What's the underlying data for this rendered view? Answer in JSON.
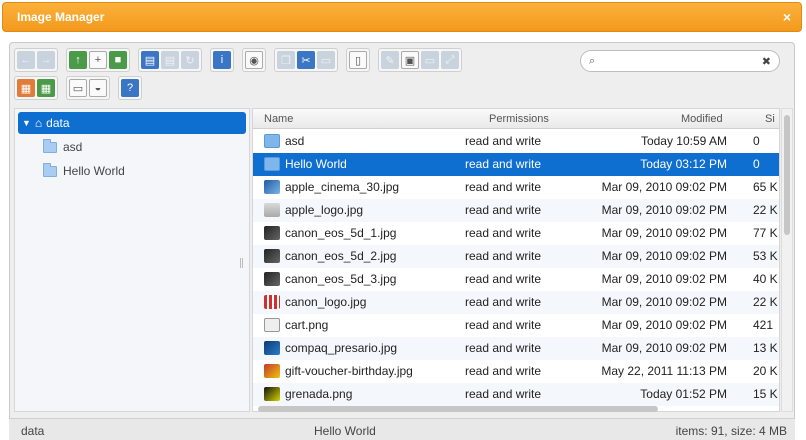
{
  "window": {
    "title": "Image Manager",
    "close_glyph": "×"
  },
  "toolbar": {
    "row1": [
      [
        {
          "icon": "back-icon",
          "glyph": "←",
          "style": "dis"
        },
        {
          "icon": "forward-icon",
          "glyph": "→",
          "style": "dis"
        }
      ],
      [
        {
          "icon": "upload-icon",
          "glyph": "↑",
          "style": "green"
        },
        {
          "icon": "new-file-icon",
          "glyph": "+",
          "style": "white"
        },
        {
          "icon": "save-icon",
          "glyph": "■",
          "style": "green"
        }
      ],
      [
        {
          "icon": "open-icon",
          "glyph": "▤",
          "style": "blue"
        },
        {
          "icon": "print-icon",
          "glyph": "▤",
          "style": "dis"
        },
        {
          "icon": "refresh-icon",
          "glyph": "↻",
          "style": "dis"
        }
      ],
      [
        {
          "icon": "info-icon",
          "glyph": "i",
          "style": "blue"
        }
      ],
      [
        {
          "icon": "preview-icon",
          "glyph": "◉",
          "style": "white"
        }
      ],
      [
        {
          "icon": "copy-icon",
          "glyph": "❐",
          "style": "dis"
        },
        {
          "icon": "cut-icon",
          "glyph": "✂",
          "style": "blue"
        },
        {
          "icon": "paste-icon",
          "glyph": "▭",
          "style": "dis"
        }
      ],
      [
        {
          "icon": "delete-icon",
          "glyph": "▯",
          "style": "white"
        }
      ],
      [
        {
          "icon": "edit-icon",
          "glyph": "✎",
          "style": "dis"
        },
        {
          "icon": "select-icon",
          "glyph": "▣",
          "style": "white"
        },
        {
          "icon": "duplicate-icon",
          "glyph": "▭",
          "style": "dis"
        },
        {
          "icon": "resize-icon",
          "glyph": "⤢",
          "style": "dis"
        }
      ]
    ],
    "row2": [
      [
        {
          "icon": "extract-icon",
          "glyph": "▦",
          "style": "orange"
        },
        {
          "icon": "archive-icon",
          "glyph": "▦",
          "style": "green"
        }
      ],
      [
        {
          "icon": "view-icon",
          "glyph": "▭",
          "style": "white"
        },
        {
          "icon": "sort-icon",
          "glyph": "◒",
          "style": "white"
        }
      ],
      [
        {
          "icon": "help-icon",
          "glyph": "?",
          "style": "blue"
        }
      ]
    ]
  },
  "search": {
    "value": "",
    "placeholder": ""
  },
  "tree": {
    "root": "data",
    "children": [
      "asd",
      "Hello World"
    ]
  },
  "columns": {
    "name": "Name",
    "permissions": "Permissions",
    "modified": "Modified",
    "size": "Si"
  },
  "files": [
    {
      "name": "asd",
      "permissions": "read and write",
      "modified": "Today 10:59 AM",
      "size": "0",
      "icon": "folder-i"
    },
    {
      "name": "Hello World",
      "permissions": "read and write",
      "modified": "Today 03:12 PM",
      "size": "0",
      "icon": "folder-i"
    },
    {
      "name": "apple_cinema_30.jpg",
      "permissions": "read and write",
      "modified": "Mar 09, 2010 09:02 PM",
      "size": "65 K",
      "icon": "blue-i"
    },
    {
      "name": "apple_logo.jpg",
      "permissions": "read and write",
      "modified": "Mar 09, 2010 09:02 PM",
      "size": "22 K",
      "icon": "grey-i"
    },
    {
      "name": "canon_eos_5d_1.jpg",
      "permissions": "read and write",
      "modified": "Mar 09, 2010 09:02 PM",
      "size": "77 K",
      "icon": "dark-i"
    },
    {
      "name": "canon_eos_5d_2.jpg",
      "permissions": "read and write",
      "modified": "Mar 09, 2010 09:02 PM",
      "size": "53 K",
      "icon": "dark-i"
    },
    {
      "name": "canon_eos_5d_3.jpg",
      "permissions": "read and write",
      "modified": "Mar 09, 2010 09:02 PM",
      "size": "40 K",
      "icon": "dark-i"
    },
    {
      "name": "canon_logo.jpg",
      "permissions": "read and write",
      "modified": "Mar 09, 2010 09:02 PM",
      "size": "22 K",
      "icon": "red-i"
    },
    {
      "name": "cart.png",
      "permissions": "read and write",
      "modified": "Mar 09, 2010 09:02 PM",
      "size": "421",
      "icon": "cart-i"
    },
    {
      "name": "compaq_presario.jpg",
      "permissions": "read and write",
      "modified": "Mar 09, 2010 09:02 PM",
      "size": "13 K",
      "icon": "navy-i"
    },
    {
      "name": "gift-voucher-birthday.jpg",
      "permissions": "read and write",
      "modified": "May 22, 2011 11:13 PM",
      "size": "20 K",
      "icon": "gift-i"
    },
    {
      "name": "grenada.png",
      "permissions": "read and write",
      "modified": "Today 01:52 PM",
      "size": "15 K",
      "icon": "gren-i"
    }
  ],
  "selected_index": 1,
  "status": {
    "path": "data",
    "selection": "Hello World",
    "summary": "items: 91, size: 4 MB"
  },
  "colors": {
    "accent": "#f39a1d",
    "selection": "#0f6fd1"
  }
}
